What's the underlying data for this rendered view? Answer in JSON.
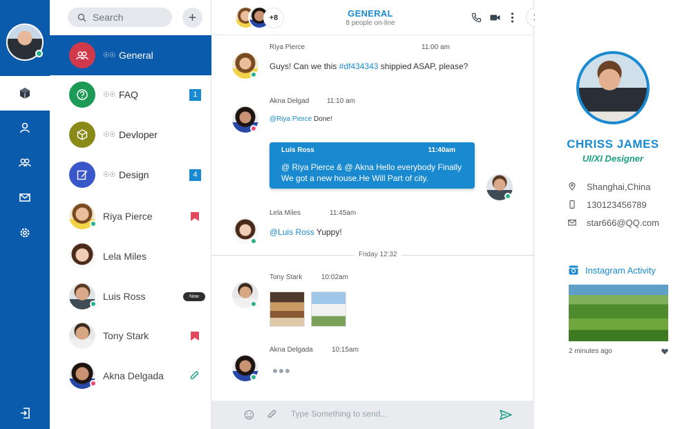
{
  "rail": {
    "items": [
      {
        "icon": "cube-icon",
        "active": true
      },
      {
        "icon": "user-icon"
      },
      {
        "icon": "users-icon"
      },
      {
        "icon": "mail-icon"
      },
      {
        "icon": "gear-icon"
      },
      {
        "icon": "logout-icon"
      }
    ]
  },
  "search": {
    "placeholder": "Search"
  },
  "conversations": [
    {
      "label": "General",
      "type": "group",
      "icon": "users-icon",
      "color": "#d0394a",
      "active": true
    },
    {
      "label": "FAQ",
      "type": "group",
      "icon": "question-icon",
      "color": "#1d9a56",
      "badge": "1"
    },
    {
      "label": "Devloper",
      "type": "group",
      "icon": "cube-icon",
      "color": "#8a8a18"
    },
    {
      "label": "Design",
      "type": "group",
      "icon": "edit-icon",
      "color": "#3a57c9",
      "badge": "4"
    },
    {
      "label": "Riya Pierce",
      "type": "person",
      "status": "#27b28a",
      "marker": "flag"
    },
    {
      "label": "Lela Miles",
      "type": "person"
    },
    {
      "label": "Luis Ross",
      "type": "person",
      "status": "#27b28a",
      "marker": "Now"
    },
    {
      "label": "Tony Stark",
      "type": "person",
      "marker": "flag"
    },
    {
      "label": "Akna Delgada",
      "type": "person",
      "status": "#e8477a",
      "marker": "clip"
    }
  ],
  "chat": {
    "header": {
      "title": "GENERAL",
      "subtitle": "8 people on-line",
      "more_count": "+8"
    },
    "messages": [
      {
        "name": "Riya Pierce",
        "time": "11:00 am",
        "text_pre": "Guys! Can we this ",
        "text_hl": "#df434343",
        "text_post": " shippied ASAP, please?"
      },
      {
        "name": "Akna Delgad",
        "time": "11:10 am",
        "mention": "@Riya Pierce",
        "text": " Done!"
      },
      {
        "name": "Luis Ross",
        "time": "11:40am",
        "text": "@ Riya Pierce & @ Akna Hello everybody Finally We got a new house.He Will Part of city."
      },
      {
        "name": "Lela Miles",
        "time": "11:45am",
        "mention": "@Luis Ross",
        "text": " Yuppy!"
      },
      {
        "name": "Tony Stark",
        "time": "10:02am"
      },
      {
        "name": "Akna Delgada",
        "time": "10:15am"
      }
    ],
    "divider": "Friday 12:32",
    "composer": {
      "placeholder": "Type Something to send..."
    }
  },
  "profile": {
    "name": "CHRISS JAMES",
    "role": "UI/XI Designer",
    "location": "Shanghai,China",
    "phone": "130123456789",
    "email": "star666@QQ.com",
    "instagram_title": "Instagram Activity",
    "instagram_time": "2  minutes ago"
  },
  "colors": {
    "primary": "#0a5bab",
    "accent": "#1a8ad0",
    "online": "#27b28a",
    "busy": "#e8477a",
    "role": "#1a9f84"
  }
}
